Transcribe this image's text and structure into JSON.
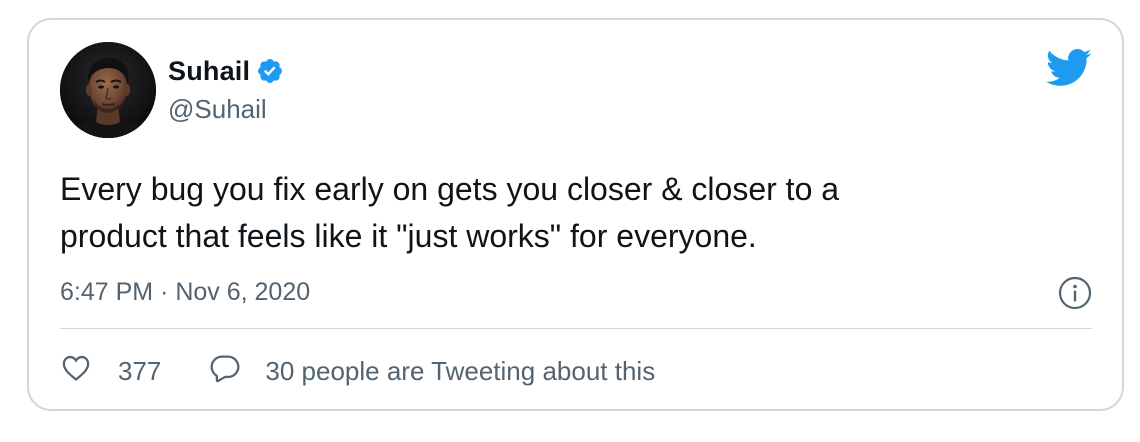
{
  "tweet": {
    "author": {
      "display_name": "Suhail",
      "handle": "@Suhail",
      "verified_icon": "verified-badge-icon",
      "avatar": "profile-photo"
    },
    "text_lines": [
      "Every bug you fix early on gets you closer & closer to a",
      "product that feels like it \"just works\" for everyone."
    ],
    "timestamp": "6:47 PM · Nov 6, 2020",
    "likes": {
      "icon": "heart-icon",
      "count": "377"
    },
    "conversation": {
      "icon": "reply-bubble-icon",
      "label": "30 people are Tweeting about this"
    },
    "logo_icon": "twitter-bird-icon",
    "info_icon": "info-icon"
  },
  "colors": {
    "brand_blue": "#1d9bf0",
    "text_primary": "#0f1419",
    "text_secondary": "#536471",
    "border": "#cfd9de"
  }
}
